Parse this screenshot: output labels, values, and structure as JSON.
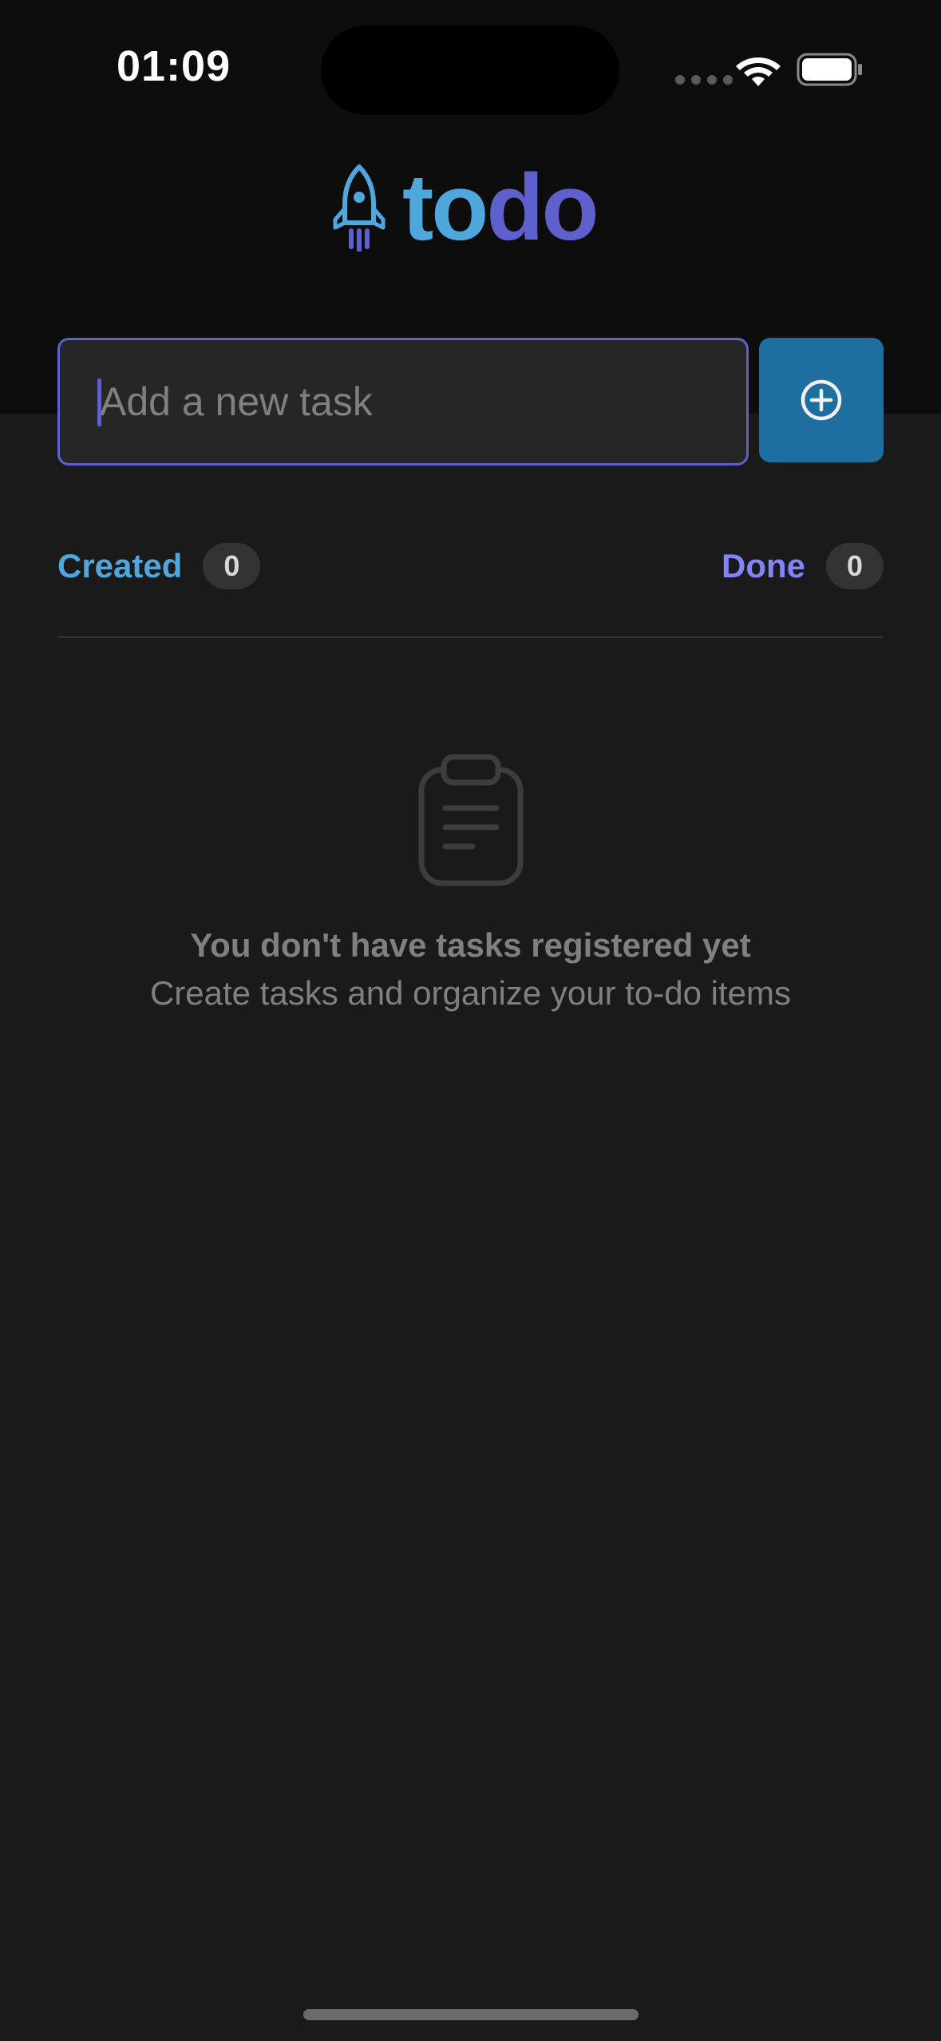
{
  "status_bar": {
    "time": "01:09"
  },
  "logo": {
    "part1": "to",
    "part2": "do",
    "icon": "rocket-icon"
  },
  "input": {
    "placeholder": "Add a new task",
    "value": ""
  },
  "add_button": {
    "icon": "plus-circle-icon"
  },
  "counters": {
    "created": {
      "label": "Created",
      "count": "0"
    },
    "done": {
      "label": "Done",
      "count": "0"
    }
  },
  "empty_state": {
    "icon": "clipboard-icon",
    "title": "You don't have tasks registered yet",
    "subtitle": "Create tasks and organize your to-do items"
  },
  "colors": {
    "background": "#1a1a1a",
    "header": "#0d0d0d",
    "blue": "#4ea8de",
    "blue_dark": "#1e6f9f",
    "purple": "#5e60ce",
    "purple_light": "#8284fa",
    "gray_text": "#808080"
  }
}
